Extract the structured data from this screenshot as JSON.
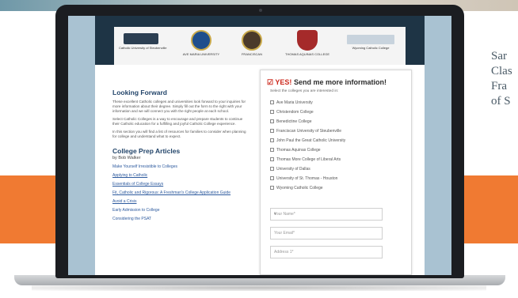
{
  "side_text": [
    "Sar",
    "Clas",
    "Fra",
    "of S"
  ],
  "banner": {
    "logos": [
      {
        "name": "Catholic University of Steubenville",
        "icon": "crest-icon"
      },
      {
        "name": "AVE MARIA UNIVERSITY",
        "icon": "seal-icon"
      },
      {
        "name": "FRANCISCAN",
        "icon": "seal-icon"
      },
      {
        "name": "THOMAS AQUINAS COLLEGE",
        "icon": "shield-icon"
      },
      {
        "name": "Wyoming Catholic College",
        "icon": "crest-icon"
      }
    ]
  },
  "left": {
    "heading": "Looking Forward",
    "paragraphs": [
      "These excellent Catholic colleges and universities look forward to your inquiries for more information about their degree. Simply fill out the form to the right with your information and we will connect you with the right people at each school.",
      "Select Catholic Colleges is a way to encourage and prepare students to continue their Catholic education for a fulfilling and joyful Catholic College experience.",
      "In this section you will find a list of resources for families to consider when planning for college and understand what to expect."
    ],
    "articles_heading": "College Prep Articles",
    "articles_sub": "by Bob Walker",
    "articles": [
      "Make Yourself Irresistible to Colleges",
      "Applying to Catholic",
      "Essentials of College Essays",
      "Fit, Catholic and Rigorous: A Freshman's College Application Guide",
      "Avoid a Crisis",
      "Early Admission to College",
      "Considering the PSAT"
    ]
  },
  "form": {
    "title_check": "☑",
    "title_yes": "YES!",
    "title_rest": " Send me more information!",
    "subtitle": "Select the colleges you are interested in:",
    "options": [
      "Ave Maria University",
      "Christendom College",
      "Benedictine College",
      "Franciscan University of Steubenville",
      "John Paul the Great Catholic University",
      "Thomas Aquinas College",
      "Thomas More College of Liberal Arts",
      "University of Dallas",
      "University of St. Thomas - Houston",
      "Wyoming Catholic College"
    ],
    "fields": [
      {
        "placeholder": "Your Name*",
        "dropdown": true
      },
      {
        "placeholder": "Your Email*",
        "dropdown": false
      },
      {
        "placeholder": "Address 1*",
        "dropdown": false
      }
    ]
  }
}
